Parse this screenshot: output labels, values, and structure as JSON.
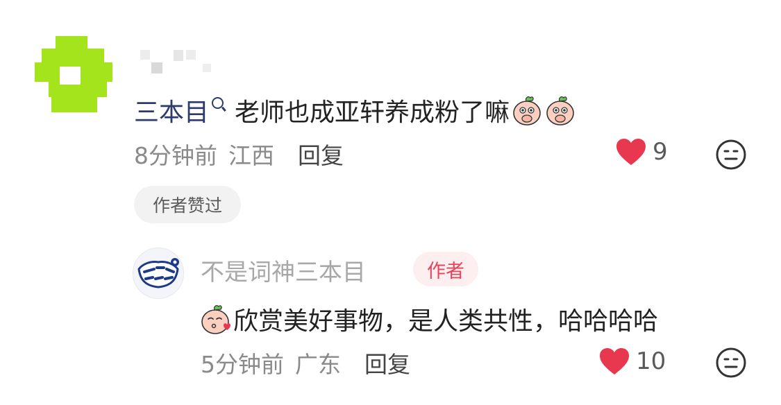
{
  "top_comment": {
    "mention": "三本目",
    "text": "老师也成亚轩养成粉了嘛",
    "time": "8分钟前",
    "location": "江西",
    "reply_label": "回复",
    "like_count": "9",
    "author_liked_label": "作者赞过",
    "emojis": [
      "peach-shy-emoji",
      "peach-shy-emoji"
    ]
  },
  "reply": {
    "username": "不是词神三本目",
    "badge": "作者",
    "text": "欣赏美好事物，是人类共性，哈哈哈哈",
    "time": "5分钟前",
    "location": "广东",
    "reply_label": "回复",
    "like_count": "10",
    "emoji": "peach-kiss-emoji"
  },
  "colors": {
    "like_heart": "#e8384f",
    "mention": "#2e3a6b",
    "author_badge_text": "#e8435a",
    "author_badge_bg": "#fdeef0",
    "avatar_placeholder": "#a4e41c"
  }
}
